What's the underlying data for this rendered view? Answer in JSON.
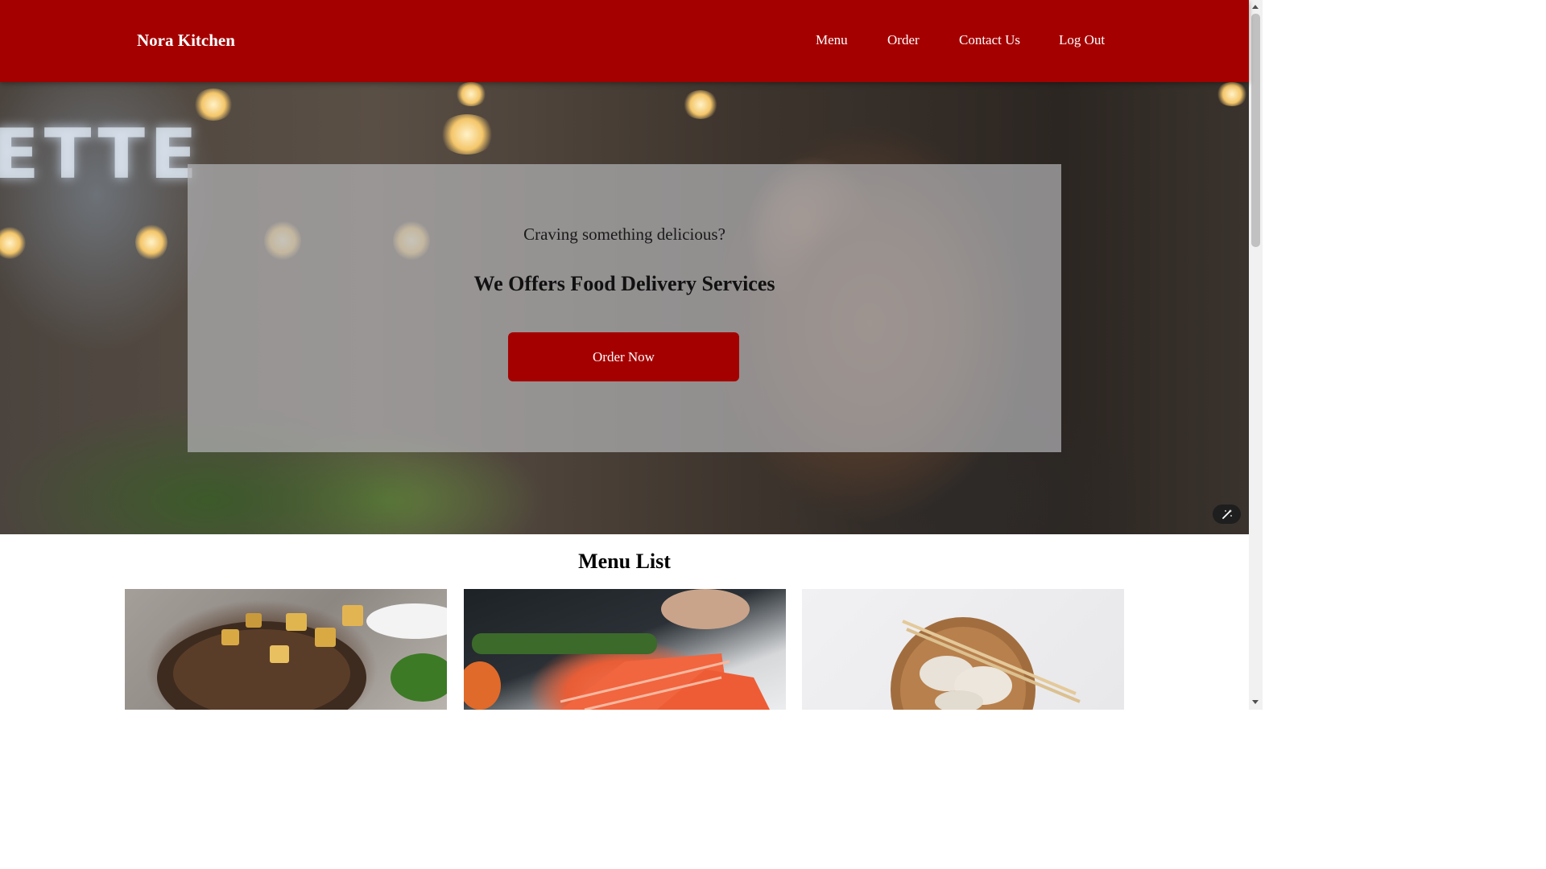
{
  "navbar": {
    "brand": "Nora Kitchen",
    "links": [
      "Menu",
      "Order",
      "Contact Us",
      "Log Out"
    ]
  },
  "hero": {
    "background_sign": "ETTE",
    "tagline": "Craving something delicious?",
    "headline": "We Offers Food Delivery Services",
    "cta_label": "Order Now"
  },
  "menu": {
    "title": "Menu List",
    "cards": [
      "grilled-pork-chop",
      "salmon-fillet",
      "dumplings-bowl"
    ]
  },
  "colors": {
    "brand_red": "#a50000",
    "overlay": "#b2b2b4",
    "text_dark": "#111111"
  },
  "icons": {
    "magic": "magic-wand-icon"
  }
}
